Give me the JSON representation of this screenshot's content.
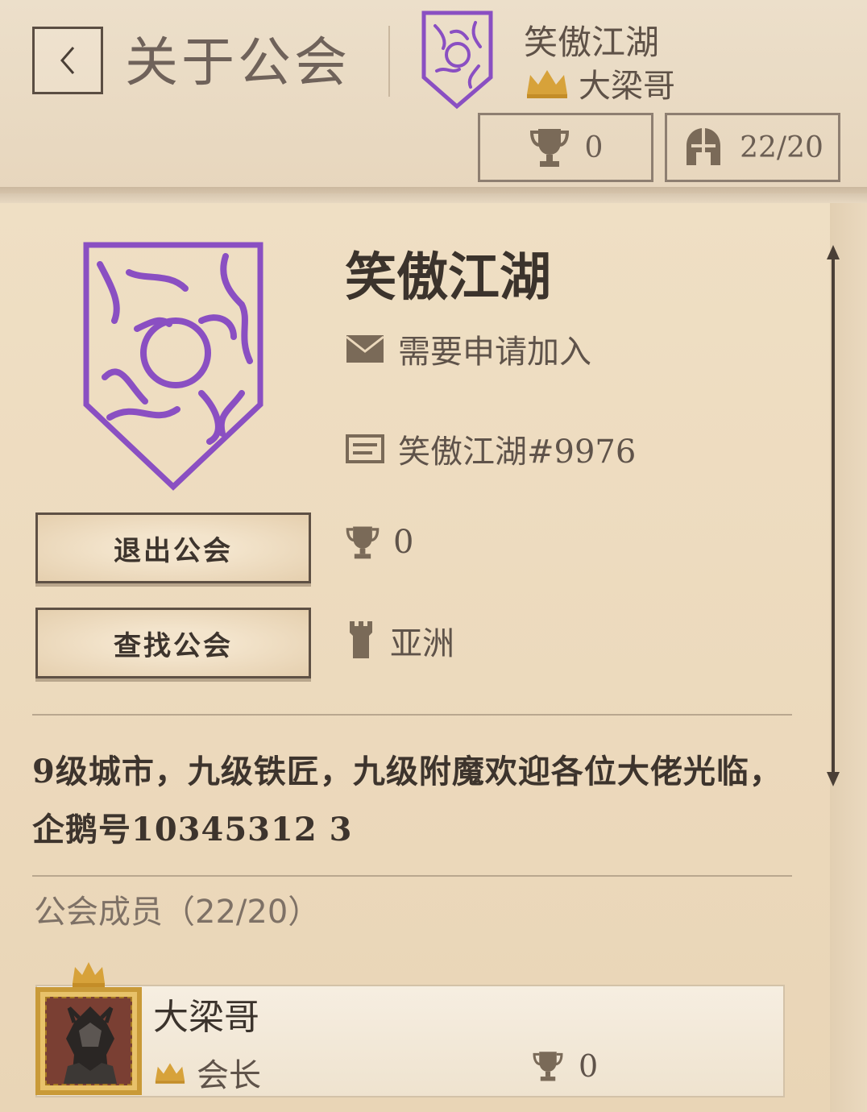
{
  "header": {
    "title": "关于公会",
    "guild_name": "笑傲江湖",
    "leader_name": "大梁哥",
    "trophies": "0",
    "members_count": "22/20"
  },
  "guild": {
    "name": "笑傲江湖",
    "join_policy": "需要申请加入",
    "tag": "笑傲江湖#9976",
    "trophies": "0",
    "region": "亚洲",
    "description": "9级城市，九级铁匠，九级附魔欢迎各位大佬光临，企鹅号10345312 3"
  },
  "buttons": {
    "leave": "退出公会",
    "find": "查找公会"
  },
  "members": {
    "title": "公会成员（22/20）",
    "list": [
      {
        "name": "大梁哥",
        "role": "会长",
        "trophies": "0"
      }
    ]
  },
  "colors": {
    "crest_purple": "#8a4fc2",
    "crown_gold": "#d7a23a",
    "icon_brown": "#7a6a58"
  },
  "icons": {
    "back": "chevron-left-icon",
    "trophy": "trophy-icon",
    "helmet": "helmet-icon",
    "mail": "mail-icon",
    "tag": "id-card-icon",
    "region": "tower-icon",
    "crown": "crown-icon"
  }
}
